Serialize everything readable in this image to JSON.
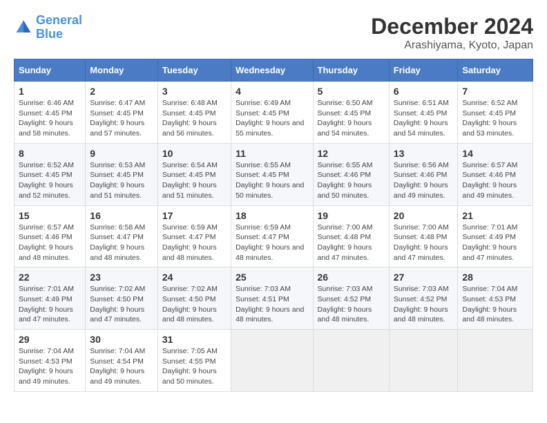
{
  "logo": {
    "line1": "General",
    "line2": "Blue"
  },
  "title": "December 2024",
  "subtitle": "Arashiyama, Kyoto, Japan",
  "days_of_week": [
    "Sunday",
    "Monday",
    "Tuesday",
    "Wednesday",
    "Thursday",
    "Friday",
    "Saturday"
  ],
  "weeks": [
    [
      {
        "day": "1",
        "sunrise": "6:46 AM",
        "sunset": "4:45 PM",
        "daylight": "9 hours and 58 minutes."
      },
      {
        "day": "2",
        "sunrise": "6:47 AM",
        "sunset": "4:45 PM",
        "daylight": "9 hours and 57 minutes."
      },
      {
        "day": "3",
        "sunrise": "6:48 AM",
        "sunset": "4:45 PM",
        "daylight": "9 hours and 56 minutes."
      },
      {
        "day": "4",
        "sunrise": "6:49 AM",
        "sunset": "4:45 PM",
        "daylight": "9 hours and 55 minutes."
      },
      {
        "day": "5",
        "sunrise": "6:50 AM",
        "sunset": "4:45 PM",
        "daylight": "9 hours and 54 minutes."
      },
      {
        "day": "6",
        "sunrise": "6:51 AM",
        "sunset": "4:45 PM",
        "daylight": "9 hours and 54 minutes."
      },
      {
        "day": "7",
        "sunrise": "6:52 AM",
        "sunset": "4:45 PM",
        "daylight": "9 hours and 53 minutes."
      }
    ],
    [
      {
        "day": "8",
        "sunrise": "6:52 AM",
        "sunset": "4:45 PM",
        "daylight": "9 hours and 52 minutes."
      },
      {
        "day": "9",
        "sunrise": "6:53 AM",
        "sunset": "4:45 PM",
        "daylight": "9 hours and 51 minutes."
      },
      {
        "day": "10",
        "sunrise": "6:54 AM",
        "sunset": "4:45 PM",
        "daylight": "9 hours and 51 minutes."
      },
      {
        "day": "11",
        "sunrise": "6:55 AM",
        "sunset": "4:45 PM",
        "daylight": "9 hours and 50 minutes."
      },
      {
        "day": "12",
        "sunrise": "6:55 AM",
        "sunset": "4:46 PM",
        "daylight": "9 hours and 50 minutes."
      },
      {
        "day": "13",
        "sunrise": "6:56 AM",
        "sunset": "4:46 PM",
        "daylight": "9 hours and 49 minutes."
      },
      {
        "day": "14",
        "sunrise": "6:57 AM",
        "sunset": "4:46 PM",
        "daylight": "9 hours and 49 minutes."
      }
    ],
    [
      {
        "day": "15",
        "sunrise": "6:57 AM",
        "sunset": "4:46 PM",
        "daylight": "9 hours and 48 minutes."
      },
      {
        "day": "16",
        "sunrise": "6:58 AM",
        "sunset": "4:47 PM",
        "daylight": "9 hours and 48 minutes."
      },
      {
        "day": "17",
        "sunrise": "6:59 AM",
        "sunset": "4:47 PM",
        "daylight": "9 hours and 48 minutes."
      },
      {
        "day": "18",
        "sunrise": "6:59 AM",
        "sunset": "4:47 PM",
        "daylight": "9 hours and 48 minutes."
      },
      {
        "day": "19",
        "sunrise": "7:00 AM",
        "sunset": "4:48 PM",
        "daylight": "9 hours and 47 minutes."
      },
      {
        "day": "20",
        "sunrise": "7:00 AM",
        "sunset": "4:48 PM",
        "daylight": "9 hours and 47 minutes."
      },
      {
        "day": "21",
        "sunrise": "7:01 AM",
        "sunset": "4:49 PM",
        "daylight": "9 hours and 47 minutes."
      }
    ],
    [
      {
        "day": "22",
        "sunrise": "7:01 AM",
        "sunset": "4:49 PM",
        "daylight": "9 hours and 47 minutes."
      },
      {
        "day": "23",
        "sunrise": "7:02 AM",
        "sunset": "4:50 PM",
        "daylight": "9 hours and 47 minutes."
      },
      {
        "day": "24",
        "sunrise": "7:02 AM",
        "sunset": "4:50 PM",
        "daylight": "9 hours and 48 minutes."
      },
      {
        "day": "25",
        "sunrise": "7:03 AM",
        "sunset": "4:51 PM",
        "daylight": "9 hours and 48 minutes."
      },
      {
        "day": "26",
        "sunrise": "7:03 AM",
        "sunset": "4:52 PM",
        "daylight": "9 hours and 48 minutes."
      },
      {
        "day": "27",
        "sunrise": "7:03 AM",
        "sunset": "4:52 PM",
        "daylight": "9 hours and 48 minutes."
      },
      {
        "day": "28",
        "sunrise": "7:04 AM",
        "sunset": "4:53 PM",
        "daylight": "9 hours and 48 minutes."
      }
    ],
    [
      {
        "day": "29",
        "sunrise": "7:04 AM",
        "sunset": "4:53 PM",
        "daylight": "9 hours and 49 minutes."
      },
      {
        "day": "30",
        "sunrise": "7:04 AM",
        "sunset": "4:54 PM",
        "daylight": "9 hours and 49 minutes."
      },
      {
        "day": "31",
        "sunrise": "7:05 AM",
        "sunset": "4:55 PM",
        "daylight": "9 hours and 50 minutes."
      },
      null,
      null,
      null,
      null
    ]
  ],
  "labels": {
    "sunrise": "Sunrise:",
    "sunset": "Sunset:",
    "daylight": "Daylight:"
  }
}
